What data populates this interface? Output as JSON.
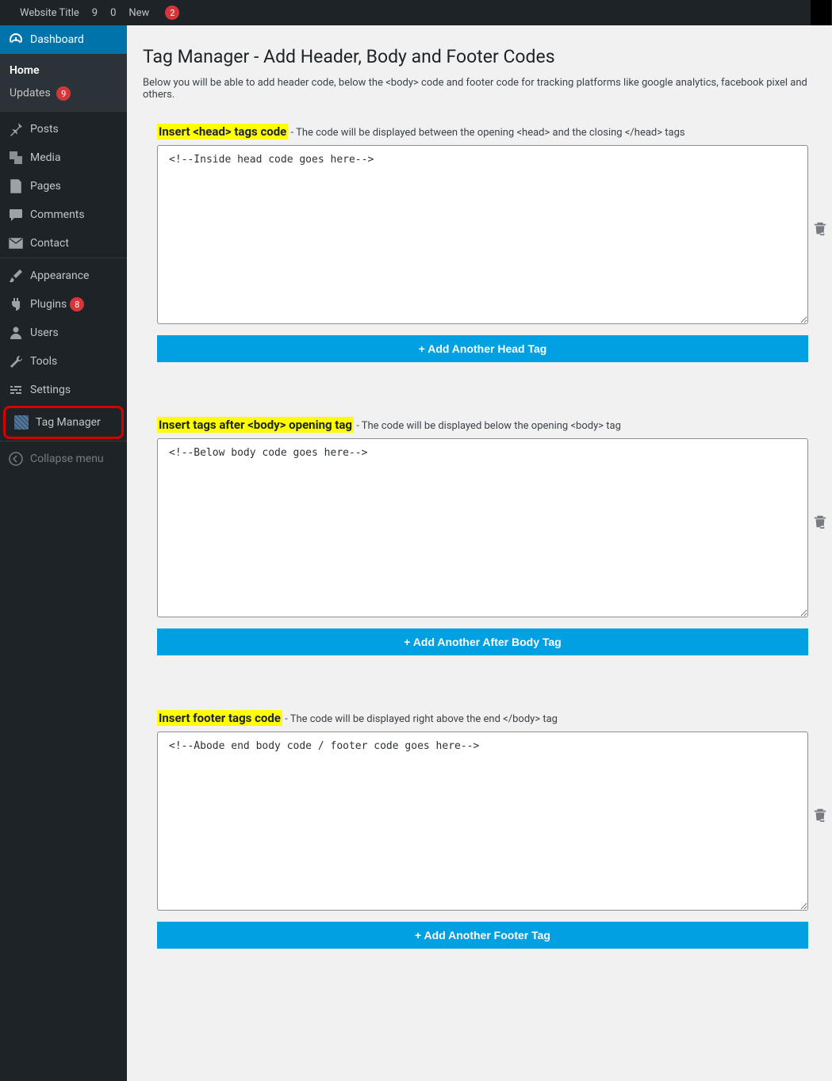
{
  "adminbar": {
    "site_title": "Website Title",
    "refresh_count": "9",
    "comments_count": "0",
    "new_label": "New",
    "yoast_badge": "2"
  },
  "sidebar": {
    "dashboard": {
      "label": "Dashboard",
      "sub_home": "Home",
      "sub_updates": "Updates",
      "sub_updates_count": "9"
    },
    "posts": "Posts",
    "media": "Media",
    "pages": "Pages",
    "comments": "Comments",
    "contact": "Contact",
    "appearance": "Appearance",
    "plugins": "Plugins",
    "plugins_count": "8",
    "users": "Users",
    "tools": "Tools",
    "settings": "Settings",
    "tag_manager": "Tag Manager",
    "collapse": "Collapse menu"
  },
  "page": {
    "title": "Tag Manager - Add Header, Body and Footer Codes",
    "intro": "Below you will be able to add header code, below the <body> code and footer code for tracking platforms like google analytics, facebook pixel and others.",
    "sections": {
      "head": {
        "heading": "Insert <head> tags code",
        "desc": " - The code will be displayed between the opening <head> and the closing </head> tags",
        "value": "<!--Inside head code goes here-->",
        "button": "+ Add Another Head Tag"
      },
      "body": {
        "heading": "Insert tags after <body> opening tag",
        "desc": " - The code will be displayed below the opening <body> tag",
        "value": "<!--Below body code goes here-->",
        "button": "+ Add Another After Body Tag"
      },
      "footer": {
        "heading": "Insert footer tags code",
        "desc": " - The code will be displayed right above the end </body> tag",
        "value": "<!--Abode end body code / footer code goes here-->",
        "button": "+ Add Another Footer Tag"
      }
    }
  }
}
